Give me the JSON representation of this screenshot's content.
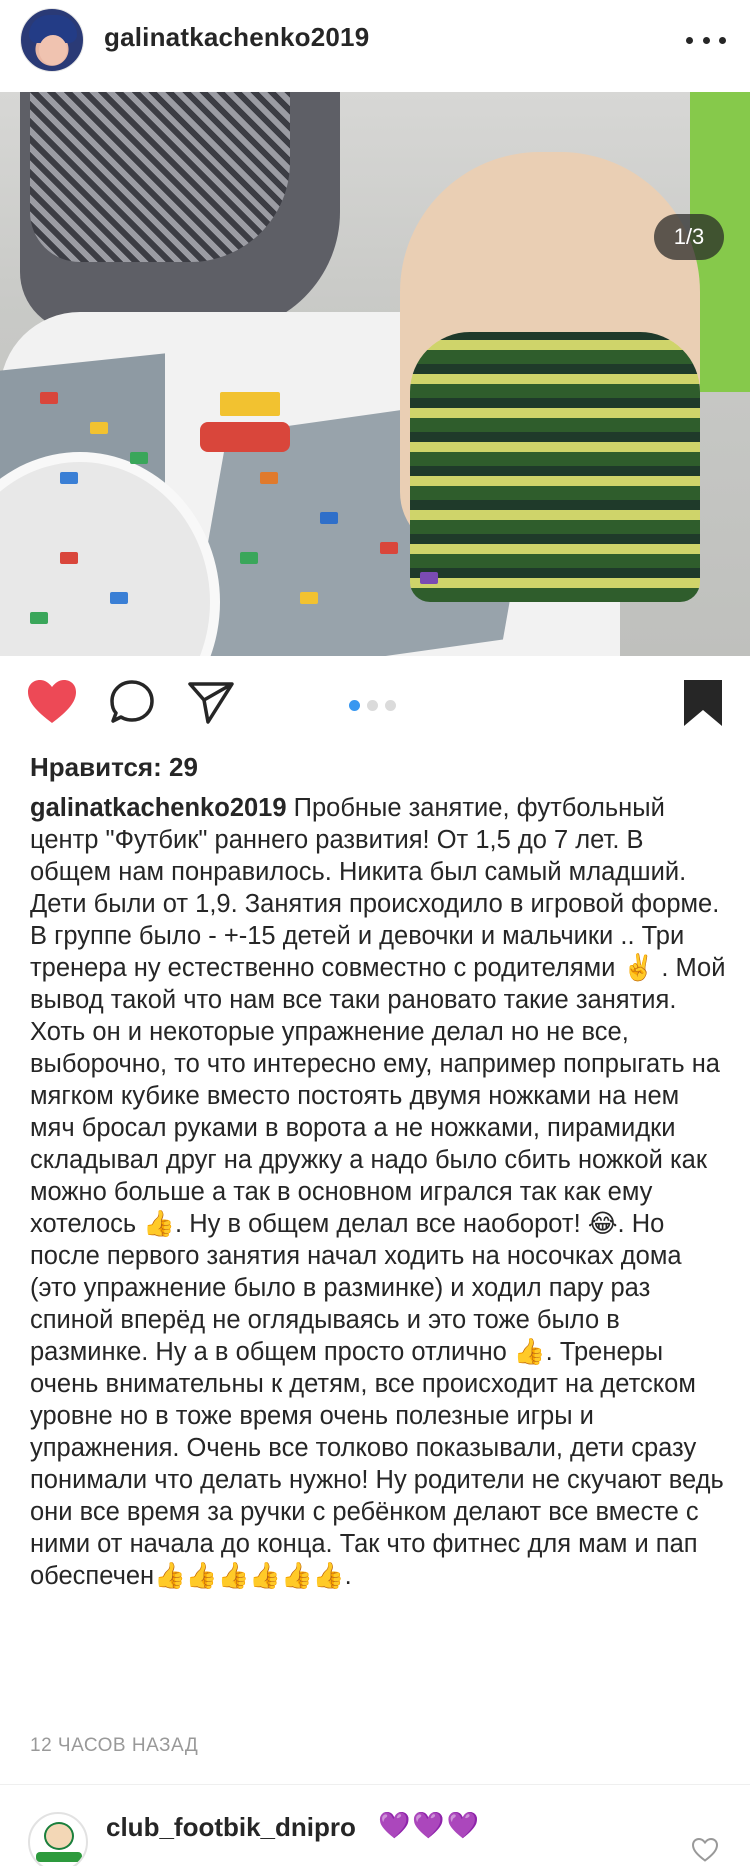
{
  "post": {
    "username": "galinatkachenko2019",
    "counter": "1/3",
    "likes": "Нравится: 29",
    "caption_user": "galinatkachenko2019",
    "caption_text": " Пробные занятие, футбольный центр \"Футбик\"  раннего развития! От 1,5 до 7 лет. В общем нам понравилось. Никита был самый младший. Дети были от 1,9. Занятия происходило в игровой форме. В группе было - +-15 детей и девочки и мальчики .. Три тренера ну естественно совместно с родителями ✌️ . Мой вывод такой что нам все таки рановато такие занятия. Хоть он и некоторые упражнение делал но не все, выборочно, то что интересно ему, например попрыгать на мягком кубике вместо постоять двумя ножками на нем  мяч бросал руками в ворота а не ножками, пирамидки складывал друг на дружку  а надо было сбить ножкой как можно больше а так в основном игрался так как ему хотелось 👍. Ну в общем делал все наоборот! 😂. Но после первого занятия начал ходить на носочках дома (это упражнение было в разминке) и ходил пару раз спиной вперёд не оглядываясь и это тоже было в разминке. Ну а в общем просто отлично 👍. Тренеры очень внимательны к детям, все происходит на детском уровне но в тоже время очень полезные игры и  упражнения. Очень все толково показывали, дети сразу понимали что делать нужно! Ну родители не скучают ведь они все время за ручки с ребёнком делают все вместе с ними от начала до конца. Так что фитнес для мам и пап обеспечен👍👍👍👍👍👍.",
    "timestamp": "12 ЧАСОВ НАЗАД",
    "carousel": {
      "total": 3,
      "active": 1
    }
  },
  "comment": {
    "username": "club_footbik_dnipro",
    "text": "💜💜💜"
  },
  "icons": {
    "like": "heart-icon",
    "comment": "comment-icon",
    "share": "share-icon",
    "save": "bookmark-icon",
    "options": "more-options-icon"
  },
  "colors": {
    "heart": "#ed4956",
    "dot_active": "#3897f0",
    "dot_inactive": "#dbdbdb",
    "text": "#262626",
    "timestamp": "#999999"
  }
}
